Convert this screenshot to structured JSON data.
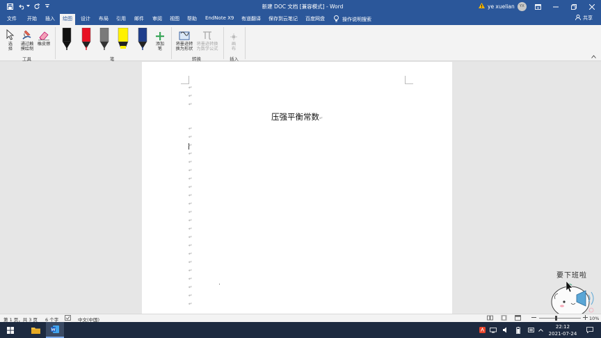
{
  "window": {
    "title": "新建 DOC 文档 [兼容模式] - Word",
    "user_name": "ye xuelian",
    "user_initials": "YX"
  },
  "tabs": [
    {
      "label": "文件",
      "active": false
    },
    {
      "label": "开始",
      "active": false
    },
    {
      "label": "插入",
      "active": false
    },
    {
      "label": "绘图",
      "active": true
    },
    {
      "label": "设计",
      "active": false
    },
    {
      "label": "布局",
      "active": false
    },
    {
      "label": "引用",
      "active": false
    },
    {
      "label": "邮件",
      "active": false
    },
    {
      "label": "审阅",
      "active": false
    },
    {
      "label": "视图",
      "active": false
    },
    {
      "label": "帮助",
      "active": false
    },
    {
      "label": "EndNote X9",
      "active": false
    },
    {
      "label": "有道翻译",
      "active": false
    },
    {
      "label": "保存到云笔记",
      "active": false
    },
    {
      "label": "百度网盘",
      "active": false
    }
  ],
  "tell_me": "操作说明搜索",
  "share": "共享",
  "ribbon": {
    "tools": {
      "label": "工具",
      "select_line1": "选",
      "select_line2": "择",
      "touch_line1": "通过触",
      "touch_line2": "摸绘制",
      "eraser": "橡皮擦"
    },
    "pens": {
      "label": "笔",
      "items": [
        {
          "name": "black-pen",
          "color": "#111111"
        },
        {
          "name": "red-pen",
          "color": "#e81123"
        },
        {
          "name": "gray-pencil",
          "color": "#7a7a7a"
        },
        {
          "name": "yellow-highlighter",
          "color": "#fff100"
        },
        {
          "name": "navy-pen",
          "color": "#1f3e8c"
        }
      ],
      "add_line1": "添加",
      "add_line2": "笔"
    },
    "convert": {
      "label": "转换",
      "shape_line1": "将墨迹转",
      "shape_line2": "换为形状",
      "math_line1": "将墨迹转换",
      "math_line2": "为数学公式"
    },
    "insert": {
      "label": "插入",
      "canvas_line1": "画",
      "canvas_line2": "布"
    }
  },
  "document": {
    "heading": "压强平衡常数",
    "paragraph_mark": "↵"
  },
  "sticker": {
    "text": "要下班啦"
  },
  "status": {
    "page": "第 1 页，共 3 页",
    "words": "6 个字",
    "language": "中文(中国)",
    "zoom": "10%"
  },
  "clock": {
    "time": "22:12",
    "date": "2021-07-24"
  },
  "colors": {
    "word_blue": "#2b579a",
    "ribbon_bg": "#f3f3f3",
    "taskbar": "#1d2a40"
  }
}
